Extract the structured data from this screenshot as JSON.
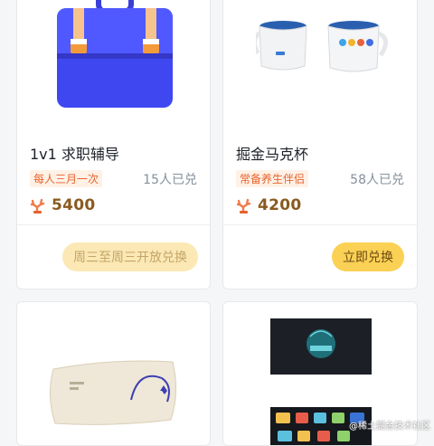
{
  "colors": {
    "accent_tag_bg": "#fff1e6",
    "accent_tag_text": "#e8632f",
    "price_text": "#8a5a1e",
    "button_active": "#fbd155",
    "button_disabled": "#fbe8b4"
  },
  "products": [
    {
      "title": "1v1 求职辅导",
      "tag": "每人三月一次",
      "redeemed": "15人已兑",
      "price": "5400",
      "button": "周三至周三开放兑换",
      "image_icon": "briefcase-icon"
    },
    {
      "title": "掘金马克杯",
      "tag": "常备养生伴侣",
      "redeemed": "58人已兑",
      "price": "4200",
      "button": "立即兑换",
      "image_icon": "mug-icon"
    },
    {
      "image_icon": "pillow-icon"
    },
    {
      "image_icon": "badge-box-icon"
    }
  ],
  "watermark": "@稀土掘金技术社区"
}
